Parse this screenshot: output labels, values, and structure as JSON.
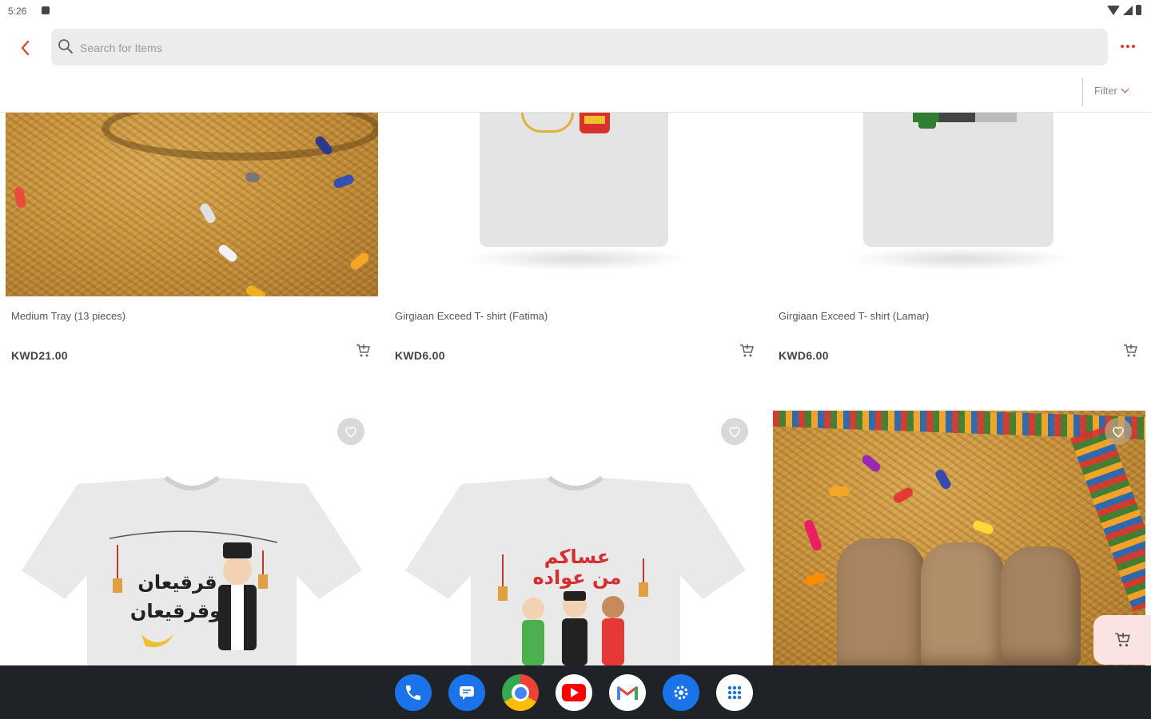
{
  "status_bar": {
    "time": "5:26"
  },
  "search": {
    "placeholder": "Search for Items"
  },
  "filter": {
    "label": "Filter"
  },
  "products": [
    {
      "title": "Medium Tray (13 pieces)",
      "price": "KWD21.00"
    },
    {
      "title": "Girgiaan Exceed T- shirt (Fatima)",
      "price": "KWD6.00"
    },
    {
      "title": "Girgiaan Exceed T- shirt (Lamar)",
      "price": "KWD6.00"
    }
  ],
  "shirt_prints": {
    "left_line1": "قرقيعان",
    "left_line2": "وقرقيعان",
    "middle_line1": "عساكم",
    "middle_line2": "من عواده"
  },
  "colors": {
    "accent": "#e53935",
    "nav_bg": "#1f2226",
    "float_cart_bg": "#fbe3e3"
  },
  "dock_apps": [
    "phone-icon",
    "messages-icon",
    "chrome-icon",
    "youtube-icon",
    "gmail-icon",
    "settings-icon",
    "app-drawer-icon"
  ]
}
